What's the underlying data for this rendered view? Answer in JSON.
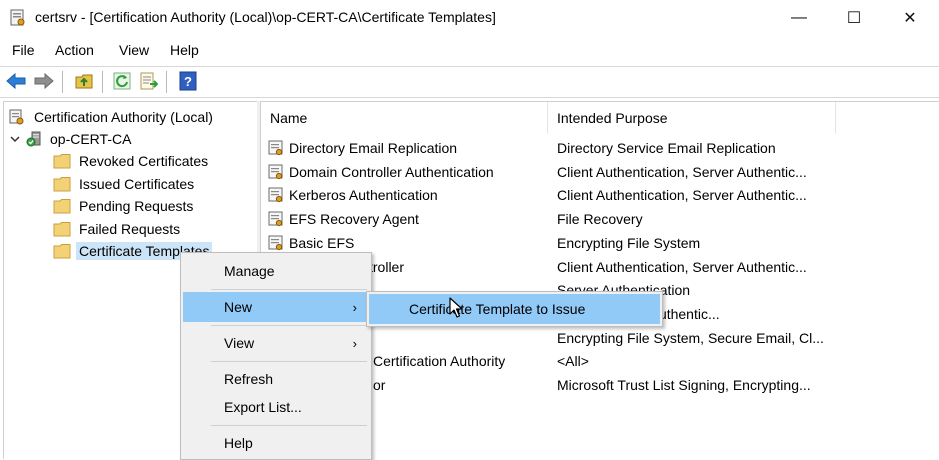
{
  "window": {
    "title": "certsrv - [Certification Authority (Local)\\op-CERT-CA\\Certificate Templates]",
    "controls": {
      "minimize": "—",
      "maximize": "☐",
      "close": "✕"
    }
  },
  "menubar": {
    "file": "File",
    "action": "Action",
    "view": "View",
    "help": "Help"
  },
  "toolbar": {
    "icons": [
      "back-icon",
      "forward-icon",
      "up-folder-icon",
      "refresh-icon",
      "export-list-icon",
      "help-icon"
    ]
  },
  "tree": {
    "root": "Certification Authority (Local)",
    "ca": "op-CERT-CA",
    "items": [
      {
        "label": "Revoked Certificates"
      },
      {
        "label": "Issued Certificates"
      },
      {
        "label": "Pending Requests"
      },
      {
        "label": "Failed Requests"
      },
      {
        "label": "Certificate Templates"
      }
    ]
  },
  "list": {
    "columns": [
      "Name",
      "Intended Purpose"
    ],
    "rows": [
      {
        "name": "Directory Email Replication",
        "purpose": "Directory Service Email Replication"
      },
      {
        "name": "Domain Controller Authentication",
        "purpose": "Client Authentication, Server Authentic..."
      },
      {
        "name": "Kerberos Authentication",
        "purpose": "Client Authentication, Server Authentic..."
      },
      {
        "name": "EFS Recovery Agent",
        "purpose": "File Recovery"
      },
      {
        "name": "Basic EFS",
        "purpose": "Encrypting File System"
      },
      {
        "name": "troller",
        "purpose": "Client Authentication, Server Authentic..."
      },
      {
        "name": "",
        "purpose": "Server Authentication"
      },
      {
        "name": "",
        "purpose": "ication, Server Authentic..."
      },
      {
        "name": "",
        "purpose": "Encrypting File System, Secure Email, Cl..."
      },
      {
        "name": "Certification Authority",
        "purpose": "<All>"
      },
      {
        "name": "or",
        "purpose": "Microsoft Trust List Signing, Encrypting..."
      }
    ]
  },
  "context_menu": {
    "manage": "Manage",
    "new": "New",
    "view": "View",
    "refresh": "Refresh",
    "export": "Export List...",
    "help": "Help",
    "submenu_arrow": "›"
  },
  "submenu": {
    "item": "Certificate Template to Issue"
  },
  "colors": {
    "highlight": "#91c9f7",
    "selection": "#cce4f7",
    "menu_bg": "#f0f0f0"
  }
}
